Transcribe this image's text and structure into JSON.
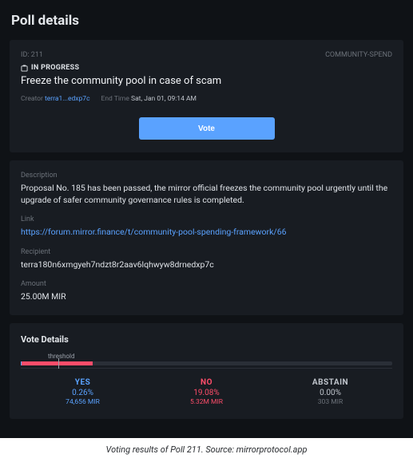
{
  "page": {
    "title": "Poll details"
  },
  "header": {
    "id_label": "ID: 211",
    "type_label": "COMMUNITY-SPEND",
    "status": "IN PROGRESS",
    "poll_title": "Freeze the community pool in case of scam",
    "creator_label": "Creator",
    "creator_value": "terra1...edxp7c",
    "endtime_label": "End Time",
    "endtime_value": "Sat, Jan 01, 09:14 AM",
    "vote_button": "Vote"
  },
  "details": {
    "description_label": "Description",
    "description_value": "Proposal No. 185 has been passed, the mirror official freezes the community pool urgently until the upgrade of safer community governance rules is completed.",
    "link_label": "Link",
    "link_value": "https://forum.mirror.finance/t/community-pool-spending-framework/66",
    "recipient_label": "Recipient",
    "recipient_value": "terra180n6xmgyeh7ndzt8r2aav6lqhwyw8drnedxp7c",
    "amount_label": "Amount",
    "amount_value": "25.00M MIR"
  },
  "votes": {
    "title": "Vote Details",
    "threshold_label": "threshold",
    "threshold_position_pct": 10,
    "yes": {
      "label": "YES",
      "pct": "0.26%",
      "amount": "74,656 MIR",
      "pct_num": 0.26
    },
    "no": {
      "label": "NO",
      "pct": "19.08%",
      "amount": "5.32M MIR",
      "pct_num": 19.08
    },
    "abstain": {
      "label": "ABSTAIN",
      "pct": "0.00%",
      "amount": "303 MIR"
    }
  },
  "caption": "Voting results of Poll 211. Source: mirrorprotocol.app"
}
